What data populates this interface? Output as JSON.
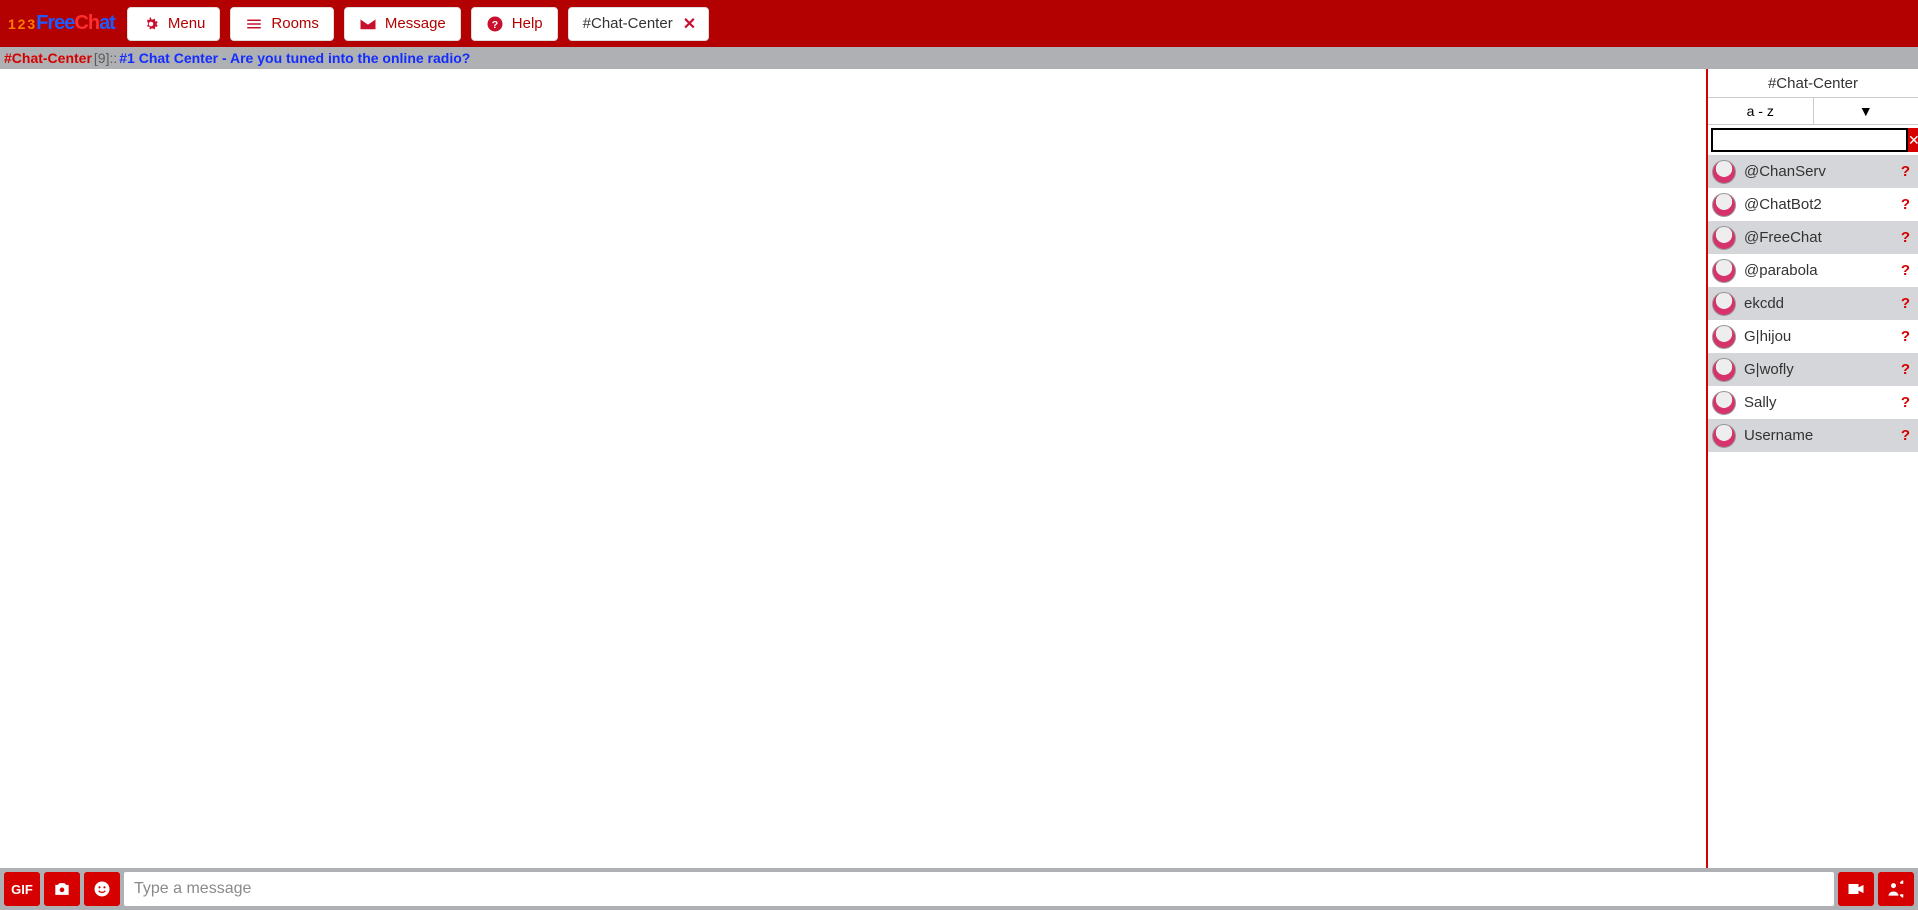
{
  "brand": {
    "pre": "1 2 3",
    "part1": "Free",
    "part2": "Ch",
    "part3": "at"
  },
  "topbar": {
    "menu": "Menu",
    "rooms": "Rooms",
    "message": "Message",
    "help": "Help",
    "tab_label": "#Chat-Center"
  },
  "topic": {
    "channel": "#Chat-Center",
    "count": " [9]::",
    "text": "#1 Chat Center - Are you tuned into the online radio?"
  },
  "sidebar": {
    "title": "#Chat-Center",
    "sort_label": "a - z",
    "sort_menu": "▼",
    "clear": "✕",
    "search_placeholder": ""
  },
  "users": [
    {
      "name": "@ChanServ"
    },
    {
      "name": "@ChatBot2"
    },
    {
      "name": "@FreeChat"
    },
    {
      "name": "@parabola"
    },
    {
      "name": "ekcdd"
    },
    {
      "name": "G|hijou"
    },
    {
      "name": "G|wofly"
    },
    {
      "name": "Sally"
    },
    {
      "name": "Username"
    }
  ],
  "input": {
    "placeholder": "Type a message"
  },
  "icons": {
    "gif": "GIF",
    "question": "?"
  }
}
